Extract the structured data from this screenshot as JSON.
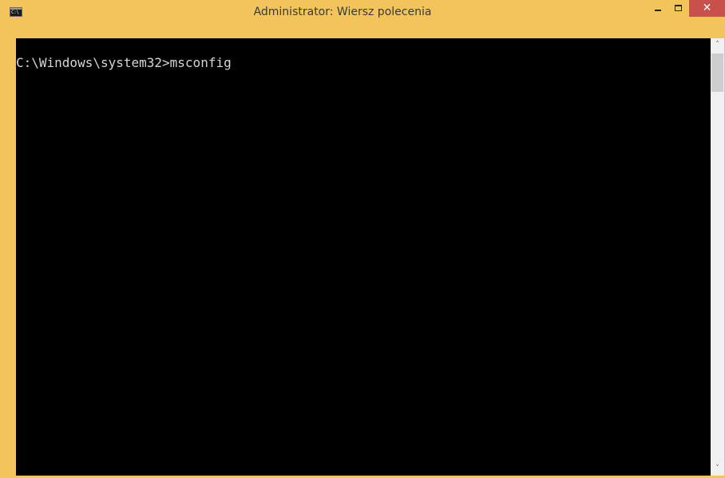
{
  "window": {
    "title": "Administrator: Wiersz polecenia",
    "app_icon_label": "C:\\",
    "controls": {
      "minimize_icon": "minimize-icon",
      "maximize_icon": "maximize-icon",
      "close_icon": "close-icon",
      "close_glyph": "✕"
    },
    "colors": {
      "frame": "#F2C45A",
      "close_button": "#C7504A",
      "console_background": "#000000",
      "console_text": "#D6D6D6",
      "scrollbar_track": "#F0F0F0",
      "scrollbar_thumb": "#CDCDCD"
    }
  },
  "console": {
    "lines": [
      "C:\\Windows\\system32>msconfig"
    ]
  },
  "scrollbar": {
    "up_glyph": "˄",
    "down_glyph": "˅"
  }
}
